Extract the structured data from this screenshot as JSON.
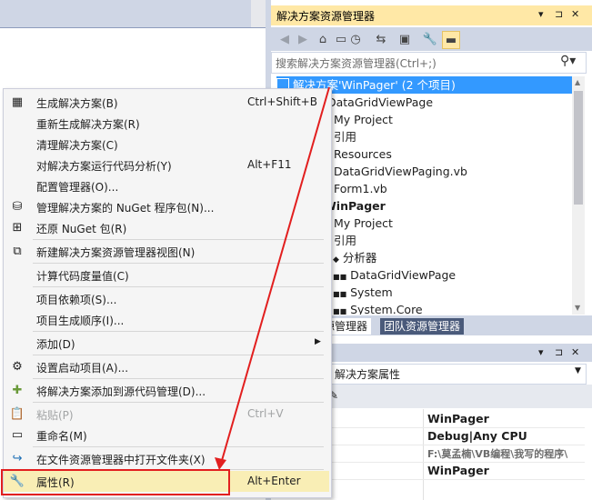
{
  "solution_explorer": {
    "title": "解决方案资源管理器",
    "title_buttons": [
      "▾",
      "⊐",
      "✕"
    ],
    "toolbar_icons": [
      "back-icon",
      "forward-icon",
      "home-icon",
      "vs-icon",
      "history-icon",
      "sync-icon",
      "properties-icon",
      "collapse-icon"
    ],
    "search_placeholder": "搜索解决方案资源管理器(Ctrl+;)",
    "tree": [
      {
        "text": "解决方案'WinPager' (2 个项目)",
        "selected": true
      },
      {
        "text": "DataGridViewPage",
        "bold": false
      },
      {
        "text": "My Project"
      },
      {
        "text": "引用"
      },
      {
        "text": "Resources"
      },
      {
        "text": "DataGridViewPaging.vb"
      },
      {
        "text": "Form1.vb"
      },
      {
        "text": "WinPager",
        "bold": true
      },
      {
        "text": "My Project"
      },
      {
        "text": "引用"
      },
      {
        "text": "分析器"
      },
      {
        "text": "DataGridViewPage"
      },
      {
        "text": "System"
      },
      {
        "text": "System.Core"
      }
    ],
    "tabs": [
      "资源管理器",
      "团队资源管理器"
    ]
  },
  "properties": {
    "title_buttons": [
      "▾",
      "⊐",
      "✕"
    ],
    "combo_text": "解决方案属性",
    "values": [
      "WinPager",
      "Debug|Any CPU",
      "F:\\莫孟楠\\VB编程\\我写的程序\\",
      "WinPager"
    ]
  },
  "menu": {
    "items": [
      {
        "label": "生成解决方案(B)",
        "shortcut": "Ctrl+Shift+B",
        "icon": "build-icon",
        "disabled": false
      },
      {
        "label": "重新生成解决方案(R)",
        "shortcut": "",
        "icon": "",
        "disabled": false
      },
      {
        "label": "清理解决方案(C)",
        "shortcut": "",
        "icon": "",
        "disabled": false
      },
      {
        "label": "对解决方案运行代码分析(Y)",
        "shortcut": "Alt+F11",
        "icon": "",
        "disabled": false
      },
      {
        "label": "配置管理器(O)...",
        "shortcut": "",
        "icon": "",
        "disabled": false
      },
      {
        "label": "管理解决方案的 NuGet 程序包(N)...",
        "shortcut": "",
        "icon": "nuget-icon",
        "disabled": false
      },
      {
        "label": "还原 NuGet 包(R)",
        "shortcut": "",
        "icon": "restore-icon",
        "disabled": false
      },
      {
        "label": "新建解决方案资源管理器视图(N)",
        "shortcut": "",
        "icon": "new-view-icon",
        "disabled": false
      },
      {
        "label": "计算代码度量值(C)",
        "shortcut": "",
        "icon": "",
        "disabled": false
      },
      {
        "label": "项目依赖项(S)...",
        "shortcut": "",
        "icon": "",
        "disabled": false
      },
      {
        "label": "项目生成顺序(I)...",
        "shortcut": "",
        "icon": "",
        "disabled": false
      },
      {
        "label": "添加(D)",
        "shortcut": "",
        "icon": "",
        "disabled": false,
        "submenu": true
      },
      {
        "label": "设置启动项目(A)...",
        "shortcut": "",
        "icon": "gear-icon",
        "disabled": false
      },
      {
        "label": "将解决方案添加到源代码管理(D)...",
        "shortcut": "",
        "icon": "source-control-icon",
        "disabled": false
      },
      {
        "label": "粘贴(P)",
        "shortcut": "Ctrl+V",
        "icon": "paste-icon",
        "disabled": true
      },
      {
        "label": "重命名(M)",
        "shortcut": "",
        "icon": "rename-icon",
        "disabled": false
      },
      {
        "label": "在文件资源管理器中打开文件夹(X)",
        "shortcut": "",
        "icon": "open-folder-icon",
        "disabled": false
      },
      {
        "label": "属性(R)",
        "shortcut": "Alt+Enter",
        "icon": "wrench-icon",
        "disabled": false
      }
    ]
  },
  "colors": {
    "annotation_red": "#e21f1f",
    "title_active": "#ffe8a6",
    "selection": "#3399ff"
  }
}
